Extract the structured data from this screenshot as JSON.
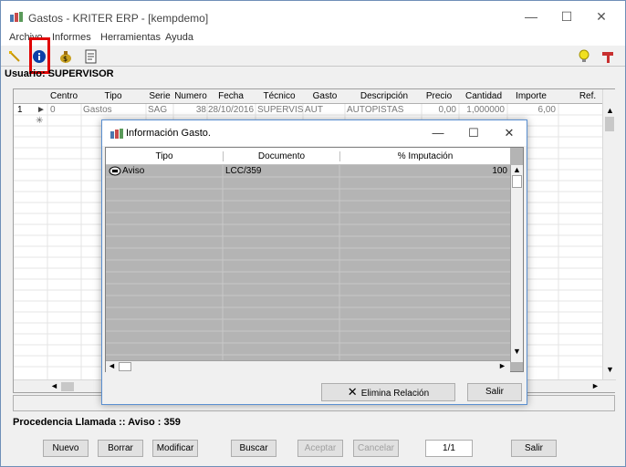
{
  "window": {
    "title": "Gastos - KRITER ERP - [kempdemo]",
    "minimize_glyph": "—",
    "maximize_glyph": "☐",
    "close_glyph": "✕"
  },
  "menu": [
    {
      "label": "Archivo"
    },
    {
      "label": "Informes"
    },
    {
      "label": "Herramientas"
    },
    {
      "label": "Ayuda"
    }
  ],
  "toolbar": {
    "icons": [
      "pencil-icon",
      "info-icon",
      "money-bag-icon",
      "notepad-icon",
      "lightbulb-icon",
      "tools-icon"
    ],
    "highlight_color": "#e00000"
  },
  "user": {
    "label": "Usuario: SUPERVISOR"
  },
  "grid": {
    "columns": [
      "Centro",
      "Tipo",
      "Serie",
      "Numero",
      "Fecha",
      "Técnico",
      "Gasto",
      "Descripción",
      "Precio",
      "Cantidad",
      "Importe",
      "Ref."
    ],
    "rows": [
      {
        "index": "1",
        "centro": "0",
        "tipo": "Gastos",
        "serie": "SAG",
        "numero": "38",
        "fecha": "28/10/2016",
        "tecnico": "SUPERVIS",
        "gasto": "AUT",
        "descripcion": "AUTOPISTAS",
        "precio": "0,00",
        "cantidad": "1,000000",
        "importe": "6,00"
      }
    ],
    "new_row_marker": "✳"
  },
  "status": {
    "procedencia": "Procedencia Llamada :: Aviso : 359"
  },
  "buttons": {
    "nuevo": "Nuevo",
    "borrar": "Borrar",
    "modificar": "Modificar",
    "buscar": "Buscar",
    "aceptar": "Aceptar",
    "cancelar": "Cancelar",
    "pager": "1/1",
    "salir": "Salir"
  },
  "dialog": {
    "title": "Información Gasto.",
    "columns": [
      "Tipo",
      "Documento",
      "% Imputación"
    ],
    "rows": [
      {
        "tipo": "Aviso",
        "documento": "LCC/359",
        "imputacion": "100"
      }
    ],
    "elimina_label": "Elimina Relación",
    "salir_label": "Salir"
  },
  "colors": {
    "dialog_grid_bg": "#b4b4b4",
    "window_border": "#6f8fb8",
    "dialog_border": "#5a8fd0"
  }
}
